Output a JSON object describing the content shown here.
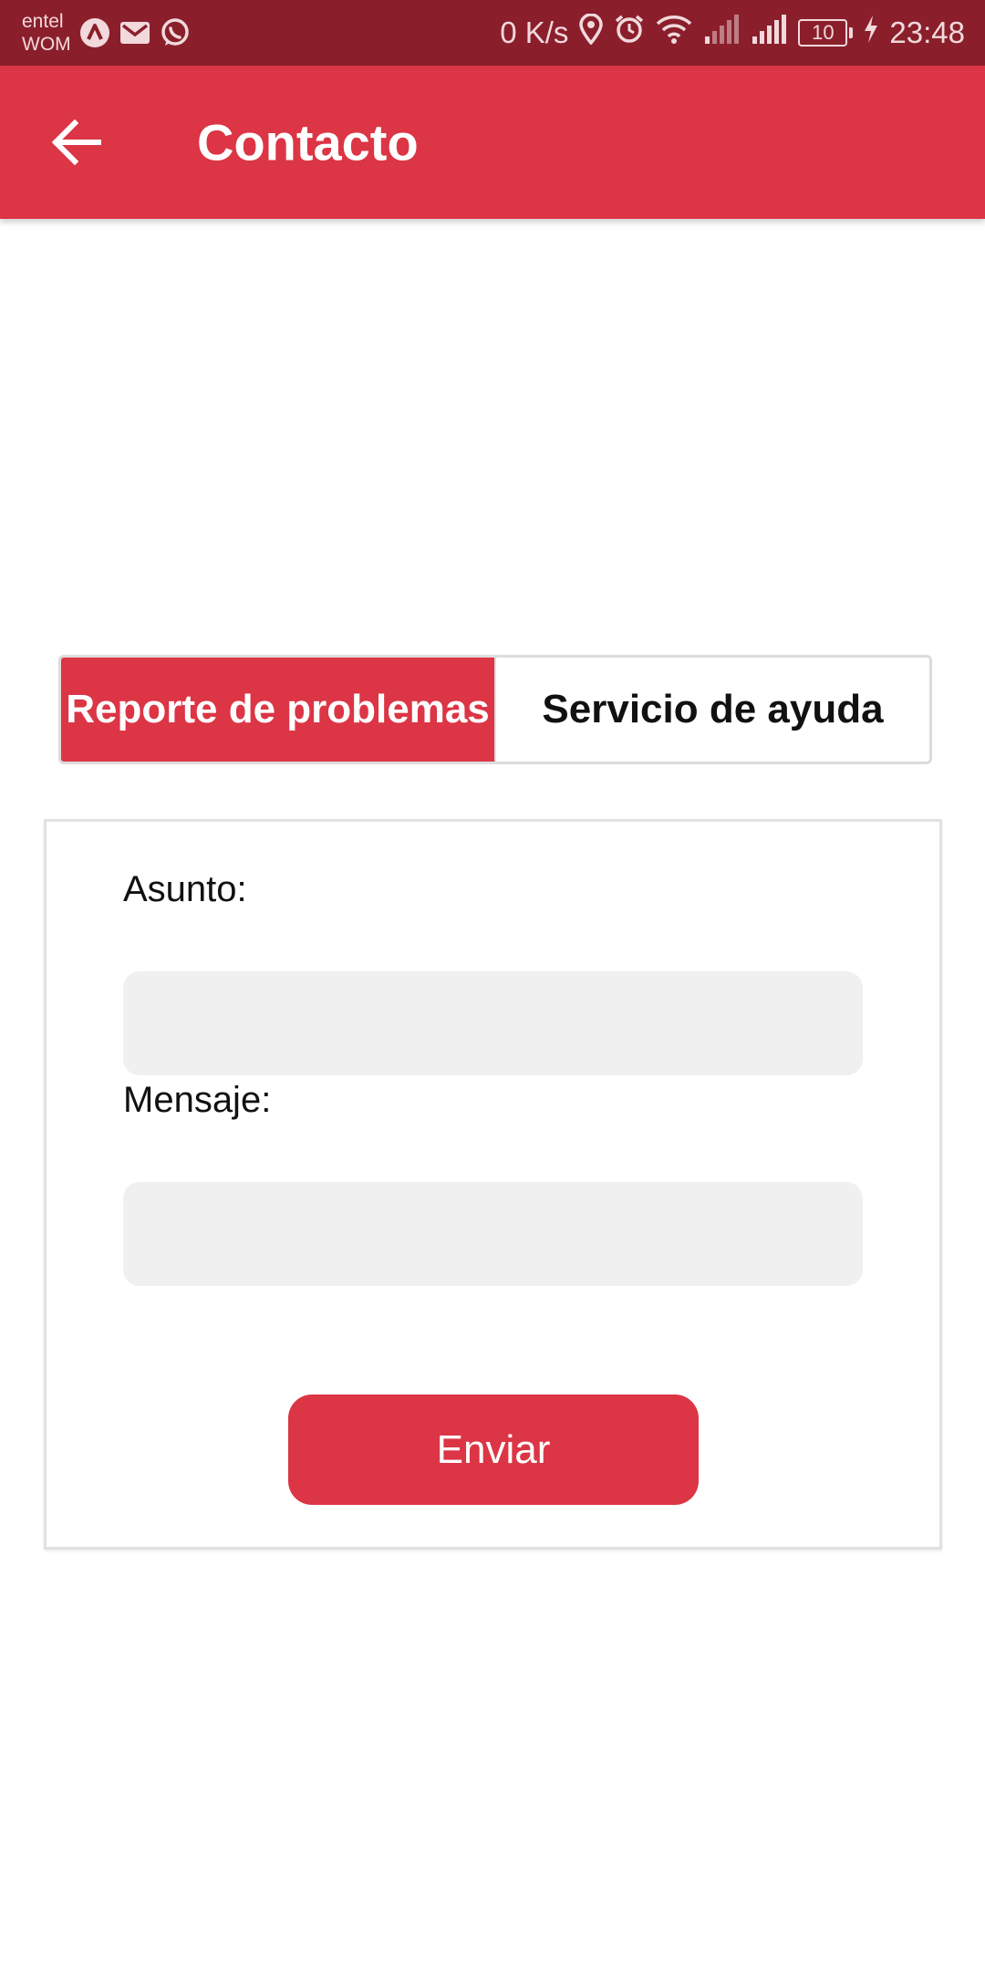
{
  "status_bar": {
    "carrier_1": "entel",
    "carrier_2": "WOM",
    "network_speed": "0 K/s",
    "battery_level": "10",
    "time": "23:48",
    "icons": [
      "app-a-icon",
      "gmail-icon",
      "whatsapp-icon",
      "location-icon",
      "alarm-icon",
      "wifi-icon",
      "signal-icon",
      "signal-icon",
      "battery-icon",
      "charging-icon"
    ]
  },
  "app_bar": {
    "title": "Contacto",
    "back_icon": "arrow-left-icon",
    "color": "#dc3545"
  },
  "tabs": [
    {
      "label": "Reporte de problemas",
      "active": true
    },
    {
      "label": "Servicio de ayuda",
      "active": false
    }
  ],
  "form": {
    "subject_label": "Asunto:",
    "subject_value": "",
    "message_label": "Mensaje:",
    "message_value": "",
    "submit_label": "Enviar"
  },
  "colors": {
    "accent": "#dc3545",
    "status_bar": "#8a1f2b",
    "input_bg": "#f0f0f0"
  }
}
